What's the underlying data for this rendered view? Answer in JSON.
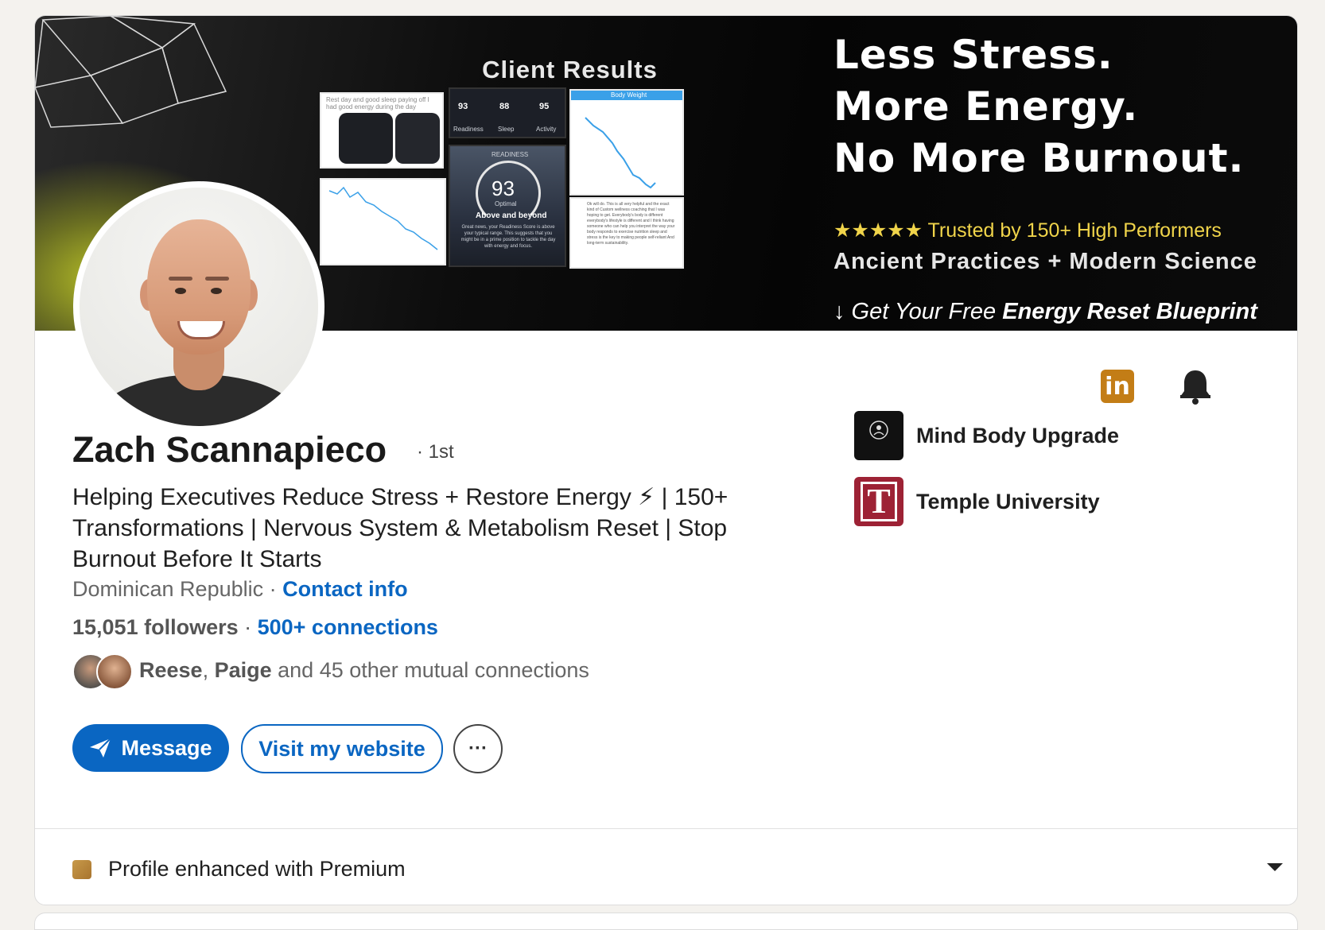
{
  "banner": {
    "client_results_title": "Client Results",
    "headline_lines": [
      "Less Stress.",
      "More Energy.",
      "No More Burnout."
    ],
    "trusted": "★★★★★ Trusted by 150+ High Performers",
    "practices": "Ancient Practices + Modern Science",
    "blueprint_prefix": "↓ Get Your Free ",
    "blueprint_bold": "Energy Reset Blueprint",
    "tiles": {
      "scores": [
        "93",
        "88",
        "95"
      ],
      "score_labels": [
        "Readiness",
        "Sleep",
        "Activity"
      ],
      "readiness_title": "READINESS",
      "readiness_value": "93",
      "readiness_status": "Optimal",
      "readiness_caption": "Above and beyond",
      "readiness_note": "Great news, your Readiness Score is above your typical range. This suggests that you might be in a prime position to tackle the day with energy and focus.",
      "chat_note": "Rest day and good sleep paying off I had good energy during the day",
      "weight_title": "Body Weight",
      "testimonial": "Ok will do. This is all very helpful and the exact kind of Custom wellness coaching that I was hoping to get. Everybody's body is different everybody's lifestyle is different and I think having someone who can help you interpret the way your body responds to exercise nutrition sleep and stress is the key to making people self-reliant And long-term sustainability."
    }
  },
  "profile": {
    "name": "Zach Scannapieco",
    "degree": "· 1st",
    "headline": "Helping Executives Reduce Stress + Restore Energy ⚡ | 150+ Transformations | Nervous System & Metabolism Reset | Stop Burnout Before It Starts",
    "location": "Dominican Republic",
    "location_sep": " · ",
    "contact_info": "Contact info",
    "followers": "15,051 followers",
    "followers_sep": " · ",
    "connections": "500+ connections",
    "mutual_name1": "Reese",
    "mutual_sep": ", ",
    "mutual_name2": "Paige",
    "mutual_rest": " and 45 other mutual connections"
  },
  "actions": {
    "message": "Message",
    "website": "Visit my website",
    "more": "···"
  },
  "right": {
    "linkedin_badge": "in",
    "orgs": [
      {
        "name": "Mind Body Upgrade",
        "logo_text": "MIND BODY UPGRADE"
      },
      {
        "name": "Temple University",
        "logo_text": "T"
      }
    ]
  },
  "footer": {
    "premium": "Profile enhanced with Premium"
  },
  "colors": {
    "link": "#0a66c2",
    "premium_gold": "#c37d16",
    "temple_red": "#9d2235",
    "banner_glow": "#d2dc28"
  },
  "icons": [
    "linkedin-premium-icon",
    "bell-icon",
    "send-icon",
    "more-icon",
    "premium-icon",
    "caret-down-icon"
  ]
}
